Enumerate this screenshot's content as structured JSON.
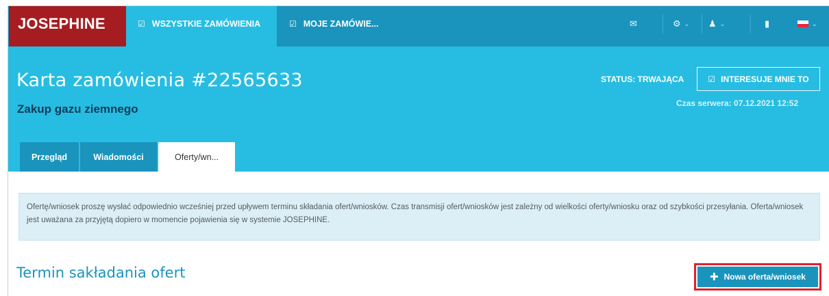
{
  "nav": {
    "logo": "JOSEPHINE",
    "tabs": [
      {
        "label": "WSZYSTKIE ZAMÓWIENIA",
        "icon": "check-square-icon"
      },
      {
        "label": "MOJE ZAMÓWIE...",
        "icon": "check-square-icon"
      }
    ],
    "right_icons": [
      "mail-icon",
      "gear-icon",
      "user-icon",
      "book-icon",
      "flag-pl-icon"
    ]
  },
  "header": {
    "title": "Karta zamówienia #22565633",
    "subtitle": "Zakup gazu ziemnego",
    "status": "STATUS: TRWAJĄCA",
    "interest_button": "INTERESUJE MNIE TO",
    "server_time": "Czas serwera: 07.12.2021 12:52"
  },
  "tabs": [
    "Przegląd",
    "Wiadomości",
    "Oferty/wn..."
  ],
  "notice": "Ofertę/wniosek proszę wysłać odpowiednio wcześniej przed upływem terminu składania ofert/wniosków. Czas transmisji ofert/wniosków jest zależny od wielkości oferty/wniosku oraz od szybkości przesyłania. Oferta/wniosek jest uważana za przyjętą dopiero w momencie pojawienia się w systemie JOSEPHINE.",
  "section": {
    "title": "Termin sakładania ofert",
    "new_offer_button": "Nowa oferta/wniosek"
  },
  "colors": {
    "nav_dark": "#1a94bd",
    "nav_light": "#27bde2",
    "logo_red": "#a51d21",
    "highlight_red": "#e0202a"
  }
}
